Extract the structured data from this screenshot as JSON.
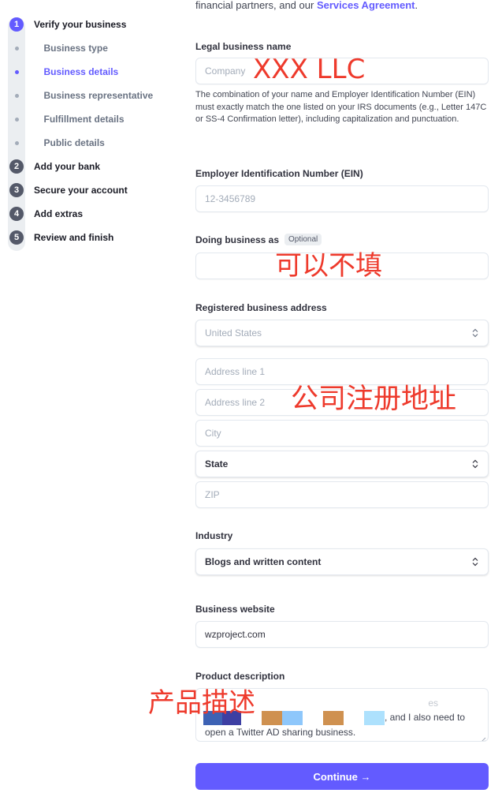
{
  "sidebar": {
    "steps": [
      {
        "number": "1",
        "label": "Verify your business",
        "active": true
      },
      {
        "number": "2",
        "label": "Add your bank"
      },
      {
        "number": "3",
        "label": "Secure your account"
      },
      {
        "number": "4",
        "label": "Add extras"
      },
      {
        "number": "5",
        "label": "Review and finish"
      }
    ],
    "substeps": [
      {
        "label": "Business type"
      },
      {
        "label": "Business details",
        "active": true
      },
      {
        "label": "Business representative"
      },
      {
        "label": "Fulfillment details"
      },
      {
        "label": "Public details"
      }
    ]
  },
  "intro": {
    "text": "financial partners, and our ",
    "link": "Services Agreement",
    "suffix": "."
  },
  "form": {
    "legal_name": {
      "label": "Legal business name",
      "placeholder": "Company",
      "value": ""
    },
    "legal_name_help": "The combination of your name and Employer Identification Number (EIN) must exactly match the one listed on your IRS documents (e.g., Letter 147C or SS-4 Confirmation letter), including capitalization and punctuation.",
    "ein": {
      "label": "Employer Identification Number (EIN)",
      "placeholder": "12-3456789",
      "value": ""
    },
    "dba": {
      "label": "Doing business as",
      "badge": "Optional",
      "value": ""
    },
    "address": {
      "label": "Registered business address",
      "country": "United States",
      "line1_placeholder": "Address line 1",
      "line2_placeholder": "Address line 2",
      "city_placeholder": "City",
      "state": "State",
      "zip_placeholder": "ZIP"
    },
    "industry": {
      "label": "Industry",
      "value": "Blogs and written content"
    },
    "website": {
      "label": "Business website",
      "value": "wzproject.com"
    },
    "product_description": {
      "label": "Product description",
      "line1_visible": "es",
      "line2_visible": ", and I also need to",
      "line3": "open a Twitter AD sharing business."
    },
    "continue_label": "Continue →"
  },
  "annotations": {
    "legal_name": "XXX LLC",
    "dba": "可以不填",
    "address": "公司注册地址",
    "product_description": "产品描述"
  },
  "colors": {
    "accent": "#635bff",
    "annotation": "#ee3a2c"
  }
}
